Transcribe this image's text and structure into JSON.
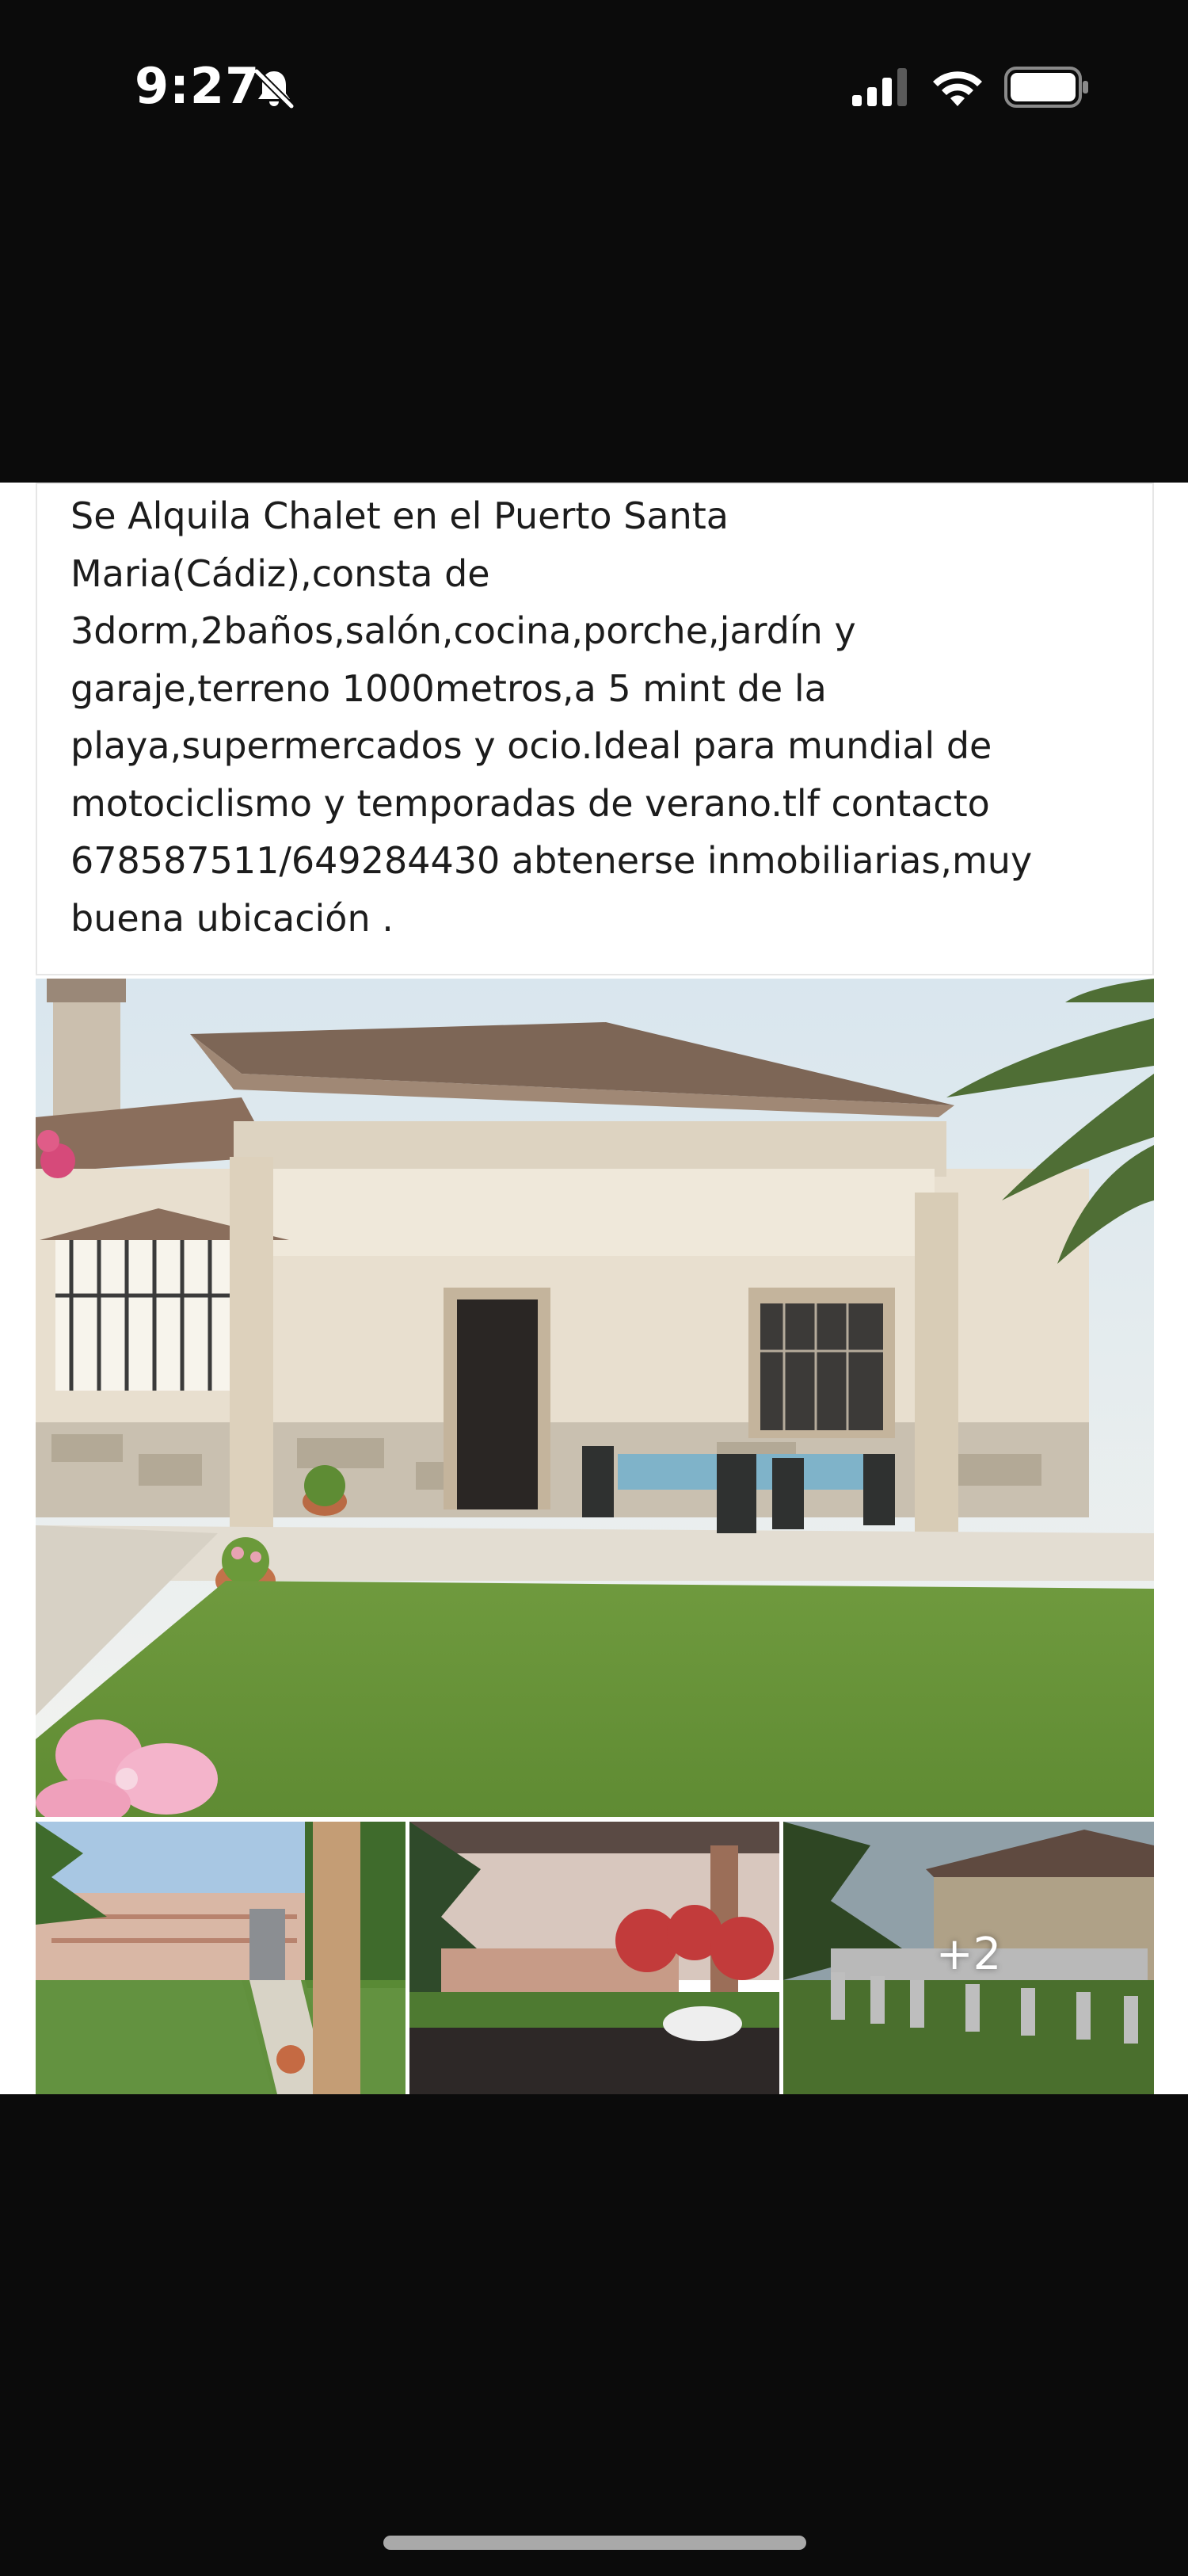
{
  "status_bar": {
    "time": "9:27",
    "icons": [
      "bell-slash-icon",
      "cellular-signal-icon",
      "wifi-icon",
      "battery-icon"
    ]
  },
  "post": {
    "text": "Se Alquila Chalet en el Puerto Santa\nMaria(Cádiz),consta de\n3dorm,2baños,salón,cocina,porche,jardín y\ngaraje,terreno 1000metros,a 5 mint de la\nplaya,supermercados y ocio.Ideal para mundial de\nmotociclismo y temporadas de verano.tlf contacto\n678587511/649284430 abtenerse inmobiliarias,muy\nbuena ubicación .",
    "photos": {
      "main": "house-photo",
      "thumbnails": [
        "garden-gate-photo",
        "porch-view-photo",
        "garden-tables-photo"
      ],
      "more_count": "+2"
    }
  },
  "colors": {
    "background": "#0b0b0b",
    "card": "#ffffff",
    "text": "#1c1c1c",
    "home_indicator": "#a9a9a9"
  }
}
